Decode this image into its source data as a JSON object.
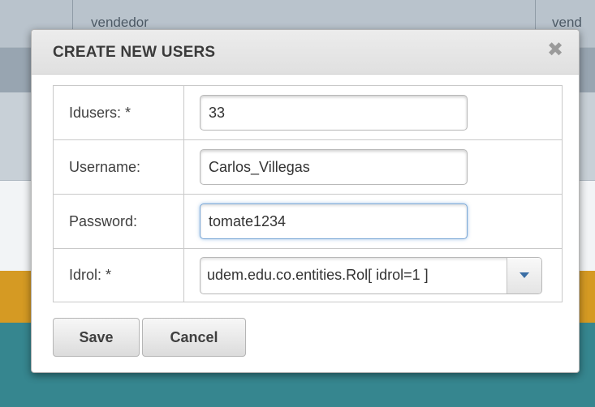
{
  "background": {
    "header_cells": [
      "vendedor",
      "vend"
    ]
  },
  "dialog": {
    "title": "CREATE NEW USERS",
    "close_icon": "close-icon",
    "fields": [
      {
        "label": "Idusers: *",
        "value": "33"
      },
      {
        "label": "Username:",
        "value": "Carlos_Villegas"
      },
      {
        "label": "Password:",
        "value": "tomate1234"
      },
      {
        "label": "Idrol: *",
        "value": "udem.edu.co.entities.Rol[ idrol=1 ]"
      }
    ],
    "save_label": "Save",
    "cancel_label": "Cancel"
  },
  "colors": {
    "orange_band": "#d59a23",
    "teal_band": "#36868f",
    "focus_ring": "#7aa7d6"
  }
}
